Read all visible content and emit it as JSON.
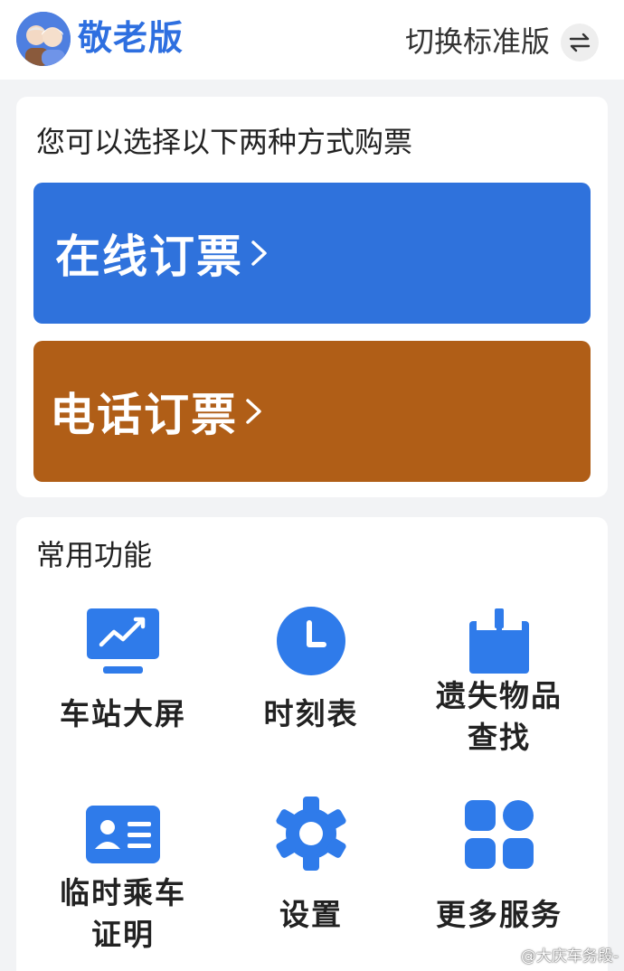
{
  "header": {
    "brand": "敬老版",
    "switch_label": "切换标准版",
    "switch_icon": "swap-arrows-icon"
  },
  "purchase": {
    "title": "您可以选择以下两种方式购票",
    "online_label": "在线订票",
    "phone_label": "电话订票",
    "colors": {
      "online": "#2f72dc",
      "phone": "#b05e17"
    }
  },
  "functions": {
    "title": "常用功能",
    "items": [
      {
        "label": "车站大屏",
        "icon": "monitor-chart-icon"
      },
      {
        "label": "时刻表",
        "icon": "clock-icon"
      },
      {
        "label_line1": "遗失物品",
        "label_line2": "查找",
        "icon": "lost-box-icon"
      },
      {
        "label_line1": "临时乘车",
        "label_line2": "证明",
        "icon": "id-card-icon"
      },
      {
        "label": "设置",
        "icon": "gear-icon"
      },
      {
        "label": "更多服务",
        "icon": "grid-apps-icon"
      }
    ]
  },
  "watermark": "@大庆车务段-",
  "accent": "#2e6fe0"
}
